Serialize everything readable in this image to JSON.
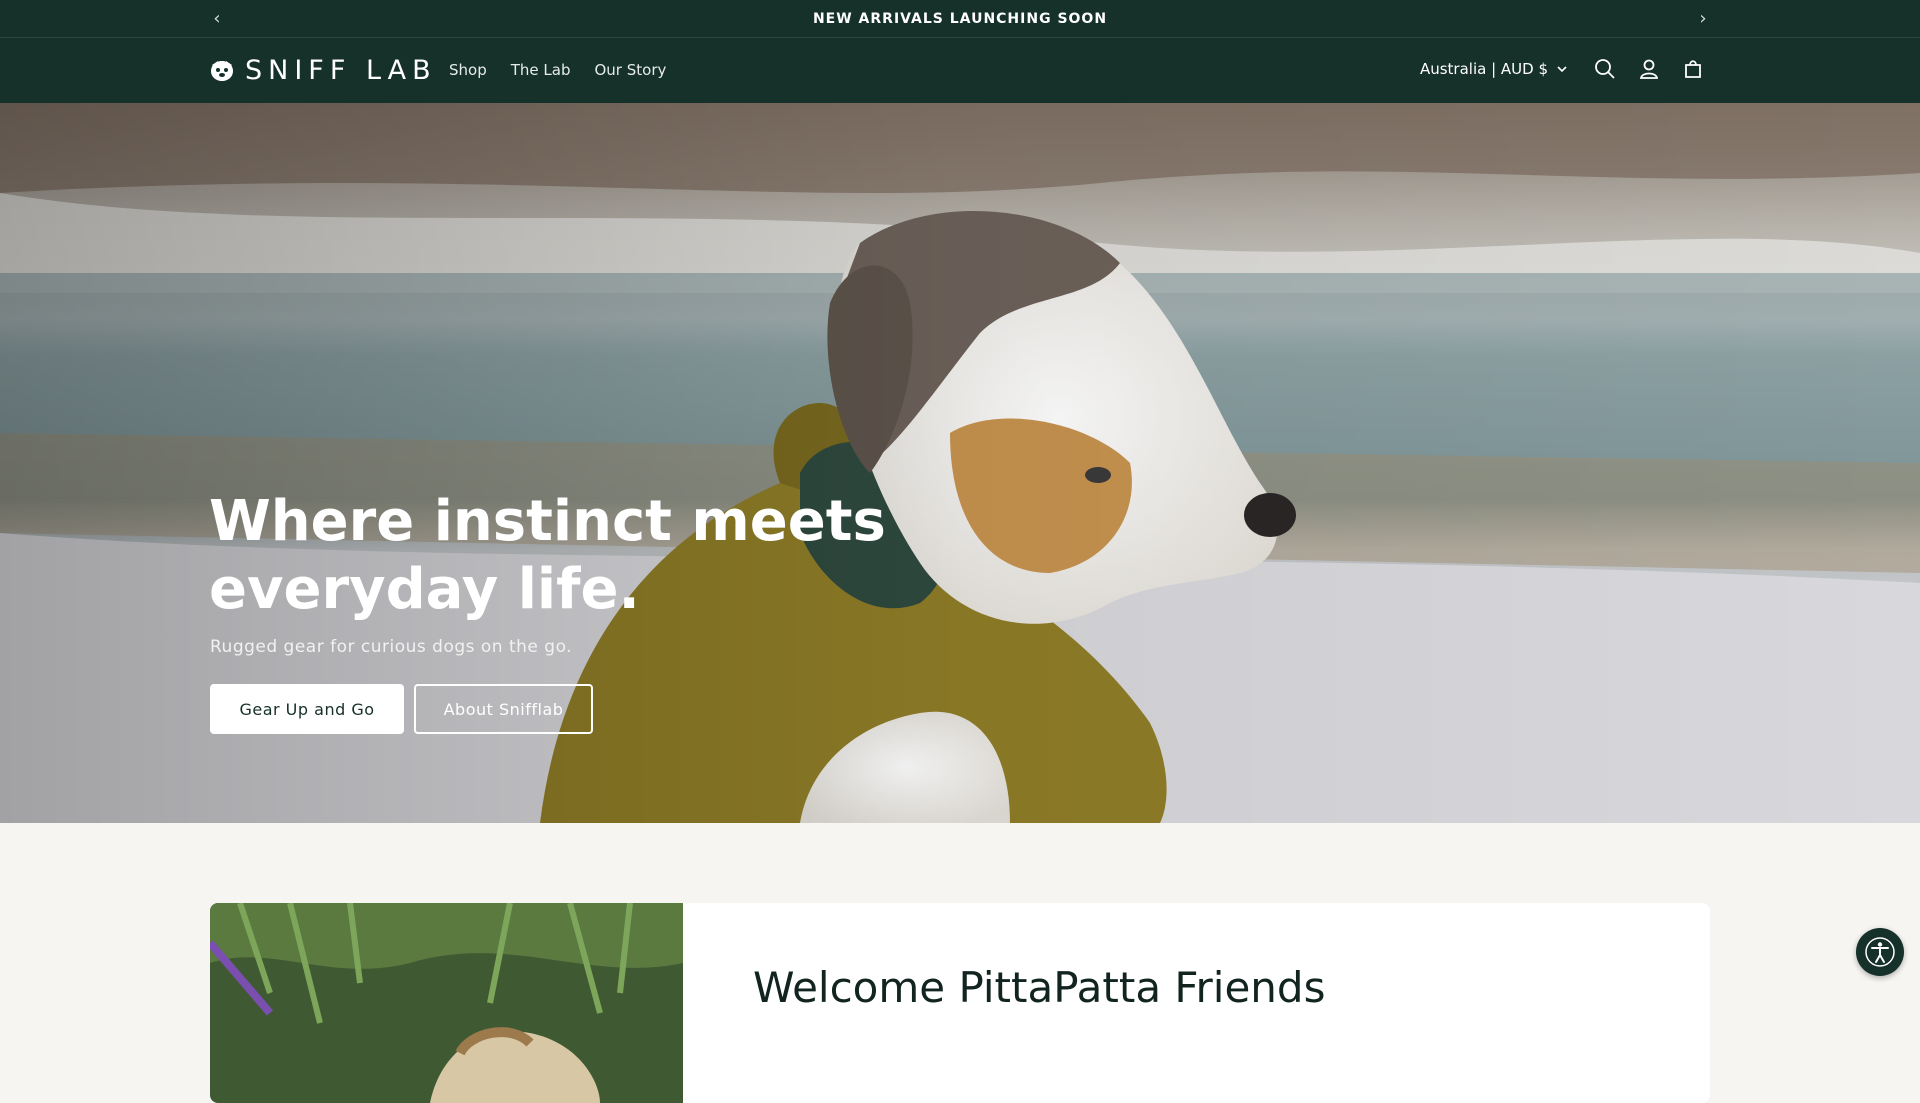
{
  "announcement": {
    "text": "NEW ARRIVALS LAUNCHING SOON",
    "prev_icon": "chevron-left-icon",
    "next_icon": "chevron-right-icon"
  },
  "header": {
    "logo_text": "SNIFF LAB",
    "nav": [
      "Shop",
      "The Lab",
      "Our Story"
    ],
    "country_selector": "Australia | AUD $",
    "icons": [
      "search-icon",
      "account-icon",
      "cart-icon"
    ]
  },
  "hero": {
    "title": "Where instinct meets everyday life.",
    "subtitle": "Rugged gear for curious dogs on the go.",
    "primary_button": "Gear Up and Go",
    "secondary_button": "About Snifflab"
  },
  "welcome": {
    "title": "Welcome PittaPatta Friends"
  },
  "colors": {
    "brand_dark": "#16302a",
    "background": "#f6f5f1",
    "white": "#ffffff"
  }
}
